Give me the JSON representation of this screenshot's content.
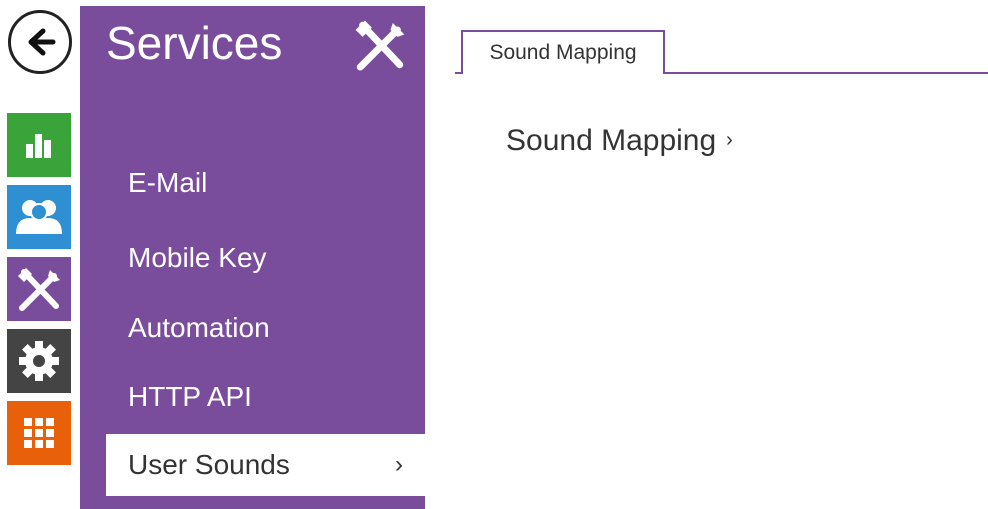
{
  "rail": {
    "items": [
      {
        "name": "back-icon"
      },
      {
        "name": "status-icon",
        "color": "#3aa43a"
      },
      {
        "name": "directory-icon",
        "color": "#2e8fd3"
      },
      {
        "name": "services-icon",
        "color": "#7a4d9c"
      },
      {
        "name": "system-icon",
        "color": "#444444"
      },
      {
        "name": "apps-icon",
        "color": "#e8600a"
      }
    ]
  },
  "services": {
    "title": "Services",
    "menu": [
      {
        "label": "E-Mail"
      },
      {
        "label": "Mobile Key"
      },
      {
        "label": "Automation"
      },
      {
        "label": "HTTP API"
      },
      {
        "label": "User Sounds",
        "active": true,
        "chevron": "›"
      }
    ]
  },
  "content": {
    "tab_label": "Sound Mapping",
    "section_link": "Sound Mapping",
    "section_chevron": "›"
  }
}
